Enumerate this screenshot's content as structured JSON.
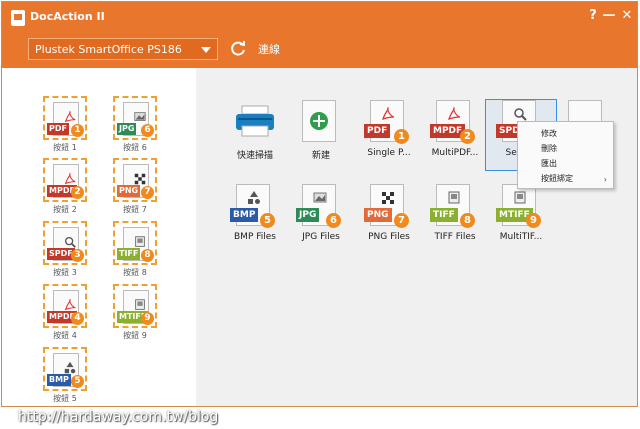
{
  "window": {
    "title": "DocAction II",
    "help": "?",
    "minimize": "—",
    "close": "✕"
  },
  "toolbar": {
    "scanner_value": "Plustek SmartOffice PS186",
    "connect_label": "連線"
  },
  "sidebar": {
    "slots": [
      {
        "tag": "PDF",
        "tag_color": "#c0392b",
        "num": "1",
        "caption": "按鈕 1"
      },
      {
        "tag": "JPG",
        "tag_color": "#2e8b57",
        "num": "6",
        "caption": "按鈕 6"
      },
      {
        "tag": "MPDF",
        "tag_color": "#c0392b",
        "num": "2",
        "caption": "按鈕 2"
      },
      {
        "tag": "PNG",
        "tag_color": "#e06a3a",
        "num": "7",
        "caption": "按鈕 7"
      },
      {
        "tag": "SPDF",
        "tag_color": "#c0392b",
        "num": "3",
        "caption": "按鈕 3"
      },
      {
        "tag": "TIFF",
        "tag_color": "#8bb030",
        "num": "8",
        "caption": "按鈕 8"
      },
      {
        "tag": "MPDF",
        "tag_color": "#c0392b",
        "num": "4",
        "caption": "按鈕 4"
      },
      {
        "tag": "MTIFF",
        "tag_color": "#8bb030",
        "num": "9",
        "caption": "按鈕 9"
      },
      {
        "tag": "BMP",
        "tag_color": "#2a5aa8",
        "num": "5",
        "caption": "按鈕 5"
      }
    ]
  },
  "main": {
    "tiles": [
      {
        "caption": "快速掃描",
        "kind": "scanner"
      },
      {
        "caption": "新建",
        "kind": "new"
      },
      {
        "caption": "Single P...",
        "tag": "PDF",
        "tag_color": "#c0392b",
        "num": "1"
      },
      {
        "caption": "MultiPDF...",
        "tag": "MPDF",
        "tag_color": "#c0392b",
        "num": "2"
      },
      {
        "caption": "Search",
        "tag": "SPD",
        "tag_color": "#c0392b",
        "num": ""
      },
      {
        "caption": "BMP Files",
        "tag": "BMP",
        "tag_color": "#2a5aa8",
        "num": "5"
      },
      {
        "caption": "JPG Files",
        "tag": "JPG",
        "tag_color": "#2e8b57",
        "num": "6"
      },
      {
        "caption": "PNG Files",
        "tag": "PNG",
        "tag_color": "#e06a3a",
        "num": "7"
      },
      {
        "caption": "TIFF Files",
        "tag": "TIFF",
        "tag_color": "#8bb030",
        "num": "8"
      },
      {
        "caption": "MultiTIF...",
        "tag": "MTIFF",
        "tag_color": "#8bb030",
        "num": "9"
      }
    ]
  },
  "context_menu": {
    "items": [
      "修改",
      "刪除",
      "匯出",
      "按鈕綁定"
    ],
    "submenu_arrow": "›"
  },
  "watermark": "http://hardaway.com.tw/blog",
  "colors": {
    "accent": "#e8762c",
    "slot_border": "#f0a030",
    "badge": "#f08a1c"
  }
}
